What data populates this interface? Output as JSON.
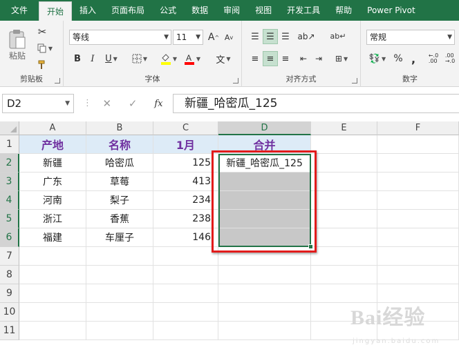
{
  "ribbon_tabs": [
    "文件",
    "开始",
    "插入",
    "页面布局",
    "公式",
    "数据",
    "审阅",
    "视图",
    "开发工具",
    "帮助",
    "Power Pivot"
  ],
  "active_tab": "开始",
  "groups": {
    "clipboard": {
      "label": "剪贴板",
      "paste": "粘贴"
    },
    "font": {
      "label": "字体",
      "name": "等线",
      "size": "11",
      "bold": "B",
      "italic": "I",
      "underline": "U",
      "grow": "A",
      "shrink": "A",
      "phonetic": "文"
    },
    "alignment": {
      "label": "对齐方式"
    },
    "number": {
      "label": "数字",
      "format": "常规",
      "percent": "%",
      "comma": ","
    }
  },
  "formula_bar": {
    "name_box": "D2",
    "fx": "fx",
    "content": "新疆_哈密瓜_125"
  },
  "columns": [
    "A",
    "B",
    "C",
    "D",
    "E",
    "F"
  ],
  "selected_column": "D",
  "rows": [
    "1",
    "2",
    "3",
    "4",
    "5",
    "6",
    "7",
    "8",
    "9",
    "10",
    "11"
  ],
  "table": {
    "headers": [
      "产地",
      "名称",
      "1月",
      "合并"
    ],
    "rows": [
      [
        "新疆",
        "哈密瓜",
        "125",
        "新疆_哈密瓜_125"
      ],
      [
        "广东",
        "草莓",
        "413",
        ""
      ],
      [
        "河南",
        "梨子",
        "234",
        ""
      ],
      [
        "浙江",
        "香蕉",
        "238",
        ""
      ],
      [
        "福建",
        "车厘子",
        "146",
        ""
      ]
    ]
  },
  "watermark": {
    "text": "Bai经验",
    "sub": "jingyan.baidu.com"
  },
  "colors": {
    "excel_green": "#217346",
    "header_fill": "#ddebf7",
    "header_text": "#7030a0",
    "highlight": "#e21b1b"
  }
}
